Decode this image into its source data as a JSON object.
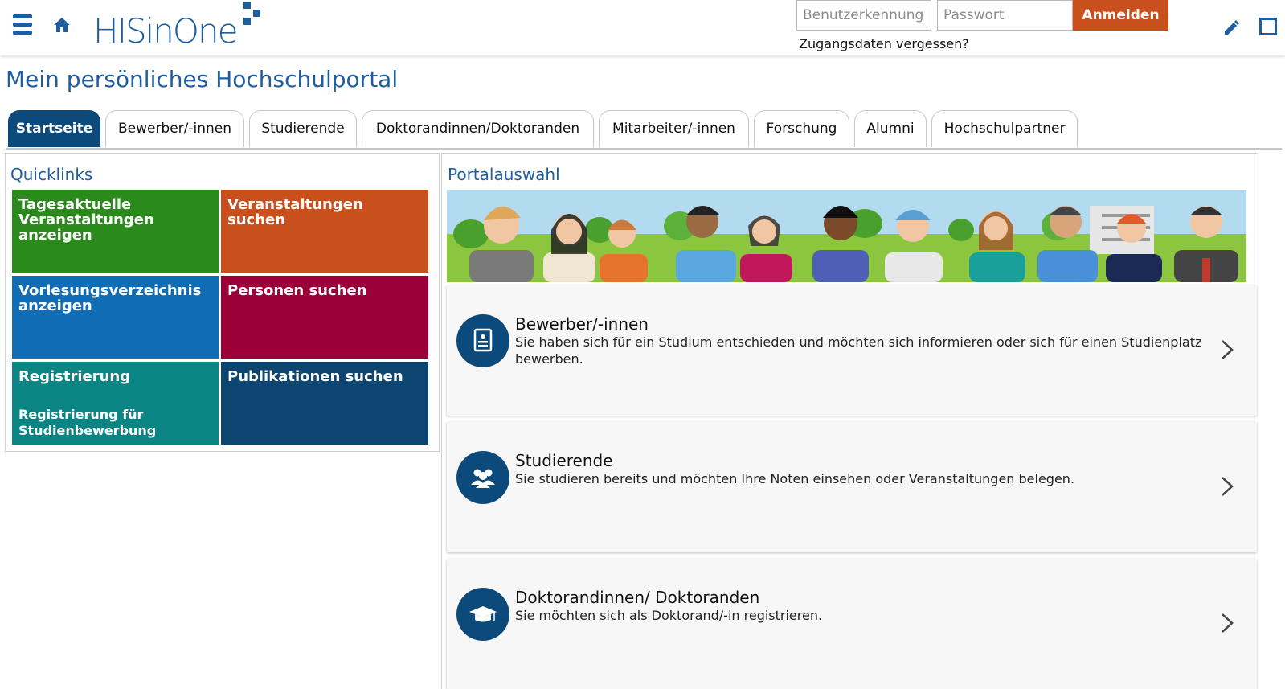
{
  "header": {
    "logo_text": "HISinOne",
    "username_placeholder": "Benutzerkennung",
    "password_placeholder": "Passwort",
    "login_button": "Anmelden",
    "forgot_link": "Zugangsdaten vergessen?"
  },
  "page_title": "Mein persönliches Hochschulportal",
  "tabs": [
    {
      "label": "Startseite",
      "active": true
    },
    {
      "label": "Bewerber/-innen"
    },
    {
      "label": "Studierende"
    },
    {
      "label": "Doktorandinnen/Doktoranden"
    },
    {
      "label": "Mitarbeiter/-innen"
    },
    {
      "label": "Forschung"
    },
    {
      "label": "Alumni"
    },
    {
      "label": "Hochschulpartner"
    }
  ],
  "quicklinks": {
    "title": "Quicklinks",
    "tiles": [
      {
        "label": "Tagesaktuelle Veranstaltungen anzeigen",
        "color": "#2a8a1c"
      },
      {
        "label": "Veranstaltungen suchen",
        "color": "#c9501c"
      },
      {
        "label": "Vorlesungsverzeichnis anzeigen",
        "color": "#0f6cb5"
      },
      {
        "label": "Personen suchen",
        "color": "#9c0039"
      },
      {
        "label": "Registrierung",
        "sublabel": "Registrierung für Studienbewerbung",
        "color": "#0b8484"
      },
      {
        "label": "Publikationen suchen",
        "color": "#0d4571"
      }
    ]
  },
  "portal": {
    "title": "Portalauswahl",
    "cards": [
      {
        "title": "Bewerber/-innen",
        "description": "Sie haben sich für ein Studium entschieden und möchten sich informieren oder sich für einen Studienplatz bewerben.",
        "icon": "document-icon"
      },
      {
        "title": "Studierende",
        "description": "Sie studieren bereits und möchten Ihre Noten einsehen oder Veranstaltungen belegen.",
        "icon": "students-icon"
      },
      {
        "title": "Doktorandinnen/ Doktoranden",
        "description": "Sie möchten sich als Doktorand/-in registrieren.",
        "icon": "graduation-cap-icon"
      }
    ]
  },
  "colors": {
    "brand_blue": "#1f5e9e",
    "dark_blue": "#0d4a7c",
    "orange": "#c9501c"
  }
}
